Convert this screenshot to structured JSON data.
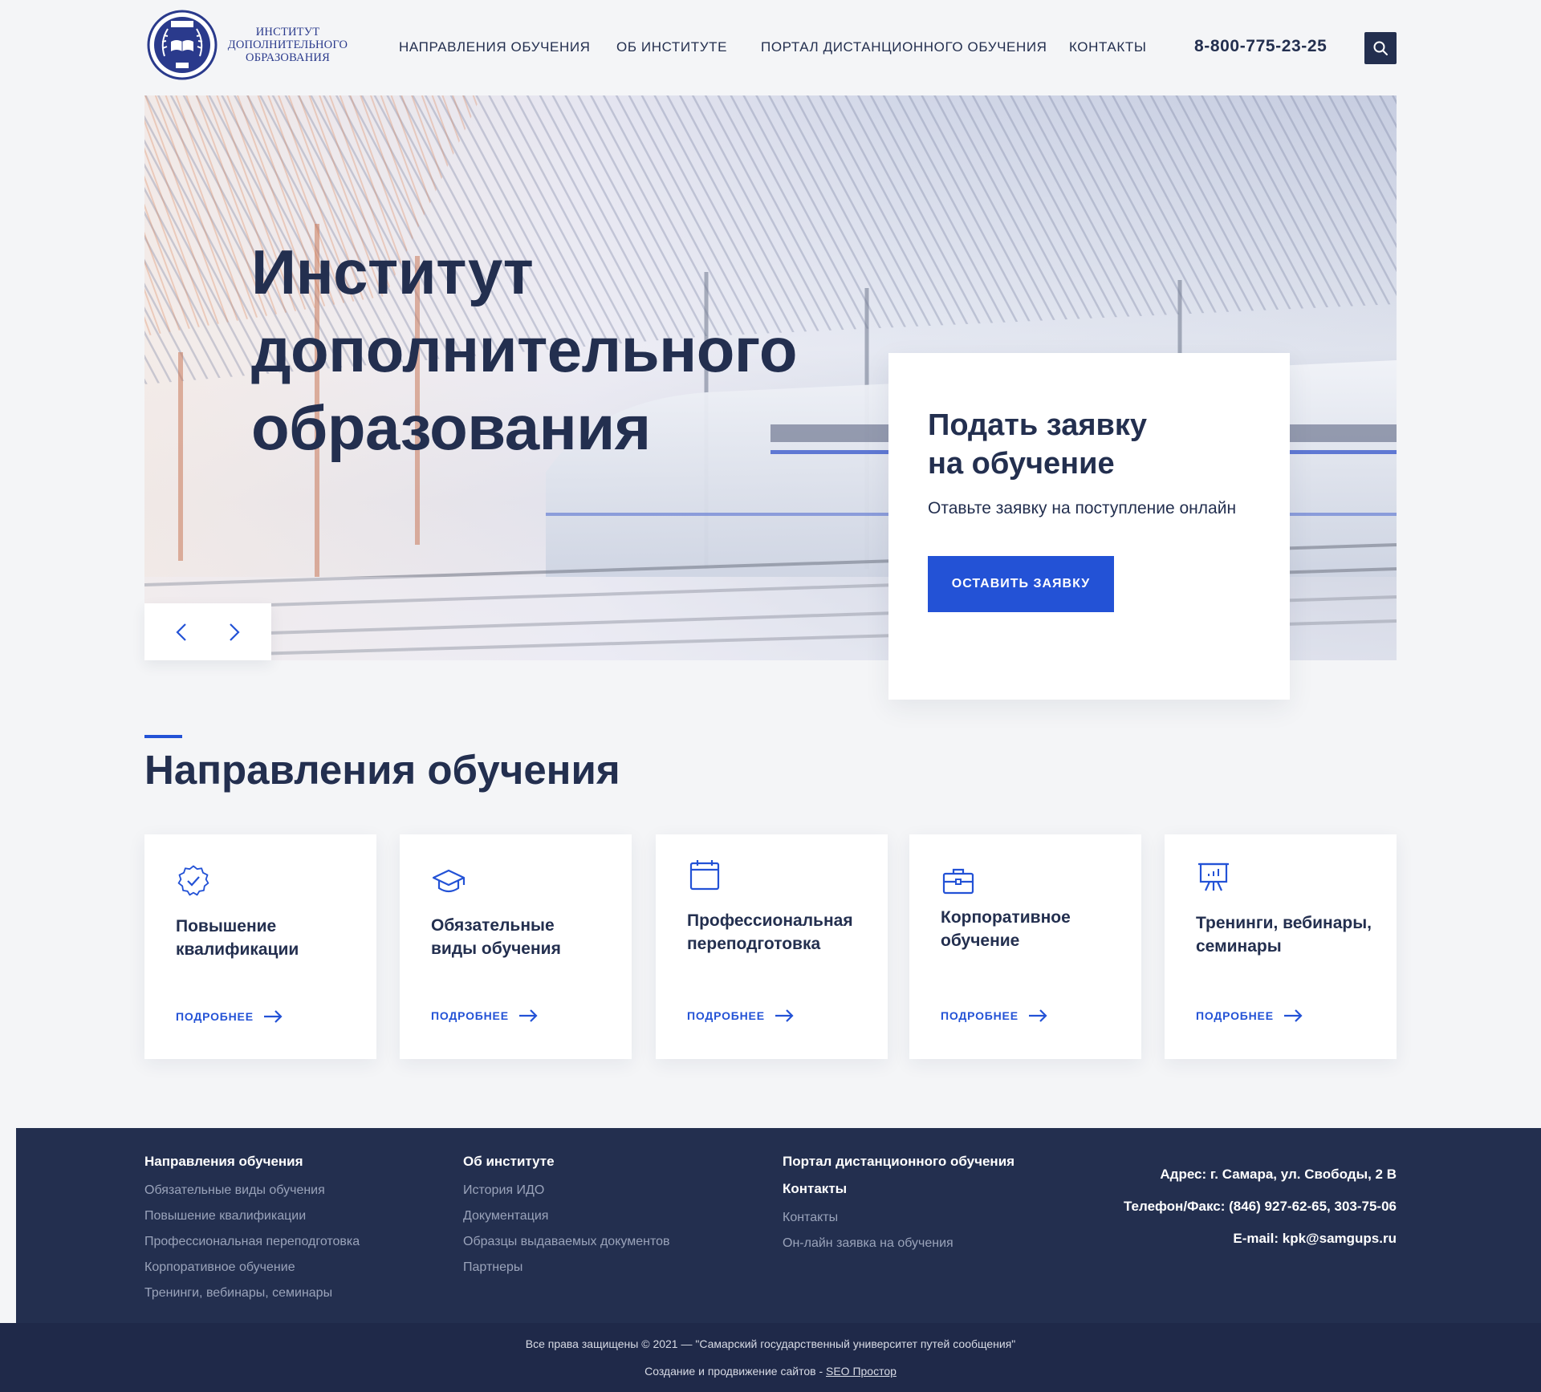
{
  "header": {
    "logo_text": [
      "ИНСТИТУТ",
      "ДОПОЛНИТЕЛЬНОГО",
      "ОБРАЗОВАНИЯ"
    ],
    "logo_seal_top": "СамГУПС",
    "logo_seal_bottom": "ИДО",
    "nav": [
      "НАПРАВЛЕНИЯ ОБУЧЕНИЯ",
      "ОБ ИНСТИТУТЕ",
      "ПОРТАЛ ДИСТАНЦИОННОГО ОБУЧЕНИЯ",
      "КОНТАКТЫ"
    ],
    "phone": "8-800-775-23-25"
  },
  "hero": {
    "title_lines": [
      "Институт",
      "дополнительного",
      "образования"
    ]
  },
  "apply": {
    "title_lines": [
      "Подать заявку",
      "на обучение"
    ],
    "subtitle": "Отавьте заявку на поступление онлайн",
    "button": "ОСТАВИТЬ ЗАЯВКУ"
  },
  "section": {
    "title": "Направления обучения"
  },
  "cards": [
    {
      "icon": "badge-check-icon",
      "title_lines": [
        "Повышение",
        "квалификации"
      ],
      "more": "ПОДРОБНЕЕ"
    },
    {
      "icon": "graduation-cap-icon",
      "title_lines": [
        "Обязательные",
        "виды обучения"
      ],
      "more": "ПОДРОБНЕЕ"
    },
    {
      "icon": "calendar-icon",
      "title_lines": [
        "Профессиональная",
        "переподготовка"
      ],
      "more": "ПОДРОБНЕЕ"
    },
    {
      "icon": "briefcase-icon",
      "title_lines": [
        "Корпоративное",
        "обучение"
      ],
      "more": "ПОДРОБНЕЕ"
    },
    {
      "icon": "presentation-icon",
      "title_lines": [
        "Тренинги, вебинары,",
        "семинары"
      ],
      "more": "ПОДРОБНЕЕ"
    }
  ],
  "footer": {
    "col1": {
      "title": "Направления обучения",
      "links": [
        "Обязательные виды обучения",
        "Повышение квалификации",
        "Профессиональная переподготовка",
        "Корпоративное обучение",
        "Тренинги, вебинары, семинары"
      ]
    },
    "col2": {
      "title": "Об институте",
      "links": [
        "История ИДО",
        "Документация",
        "Образцы выдаваемых документов",
        "Партнеры"
      ]
    },
    "col3": {
      "title": "Портал дистанционного обучения",
      "title2": "Контакты",
      "links": [
        "Контакты",
        "Он-лайн заявка на обучения"
      ]
    },
    "contacts": {
      "address": "Адрес: г. Самара, ул. Свободы, 2 В",
      "phone": "Телефон/Факс: (846) 927-62-65, 303-75-06",
      "email": "E-mail: kpk@samgups.ru"
    }
  },
  "bottom": {
    "copyright": "Все права защищены © 2021 — \"Самарский государственный университет путей сообщения\"",
    "credit_prefix": "Создание и продвижение сайтов - ",
    "credit_link": "SEO Простор"
  },
  "colors": {
    "accent": "#2352d6",
    "dark": "#232f4f",
    "background": "#f4f5f7"
  }
}
